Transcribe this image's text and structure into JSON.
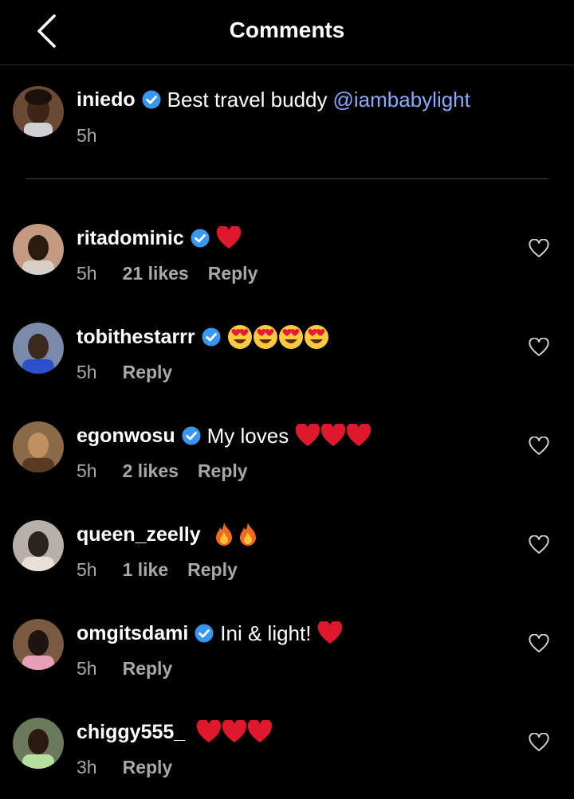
{
  "header": {
    "title": "Comments"
  },
  "caption": {
    "username": "iniedo",
    "verified": true,
    "text": "Best travel buddy",
    "mention": "@iambabylight",
    "time": "5h"
  },
  "comments": [
    {
      "username": "ritadominic",
      "verified": true,
      "text": "",
      "emojis": [
        "red-heart"
      ],
      "time": "5h",
      "likes": "21 likes",
      "reply": "Reply"
    },
    {
      "username": "tobithestarrr",
      "verified": true,
      "text": "",
      "emojis": [
        "heart-eyes",
        "heart-eyes",
        "heart-eyes",
        "heart-eyes"
      ],
      "time": "5h",
      "likes": "",
      "reply": "Reply"
    },
    {
      "username": "egonwosu",
      "verified": true,
      "text": "My loves",
      "emojis": [
        "red-heart",
        "red-heart",
        "red-heart"
      ],
      "time": "5h",
      "likes": "2 likes",
      "reply": "Reply"
    },
    {
      "username": "queen_zeelly",
      "verified": false,
      "text": "",
      "emojis": [
        "fire",
        "fire"
      ],
      "time": "5h",
      "likes": "1 like",
      "reply": "Reply"
    },
    {
      "username": "omgitsdami",
      "verified": true,
      "text": "Ini & light!",
      "emojis": [
        "red-heart"
      ],
      "time": "5h",
      "likes": "",
      "reply": "Reply"
    },
    {
      "username": "chiggy555_",
      "verified": false,
      "text": "",
      "emojis": [
        "red-heart",
        "red-heart",
        "red-heart"
      ],
      "time": "3h",
      "likes": "",
      "reply": "Reply"
    }
  ],
  "colors": {
    "background": "#000000",
    "mention": "#8aa8ff",
    "verified": "#3897f0",
    "meta": "#a8a8a8",
    "heart_emoji": "#e0182d"
  }
}
